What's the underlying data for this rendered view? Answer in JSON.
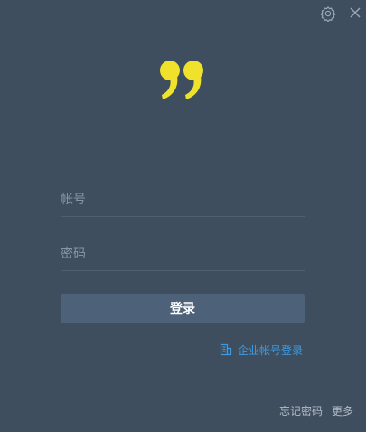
{
  "toolbar": {
    "settings_icon": "gear-icon",
    "close_icon": "close-icon"
  },
  "logo": {
    "icon": "quote-logo",
    "color": "#f0e22a"
  },
  "form": {
    "username_placeholder": "帐号",
    "password_placeholder": "密码",
    "login_label": "登录"
  },
  "enterprise": {
    "label": "企业帐号登录",
    "icon": "building-icon",
    "color": "#3d9be6"
  },
  "footer": {
    "forgot_password": "忘记密码",
    "more": "更多"
  },
  "colors": {
    "background": "#3e4e5e",
    "button": "#4d6178"
  }
}
